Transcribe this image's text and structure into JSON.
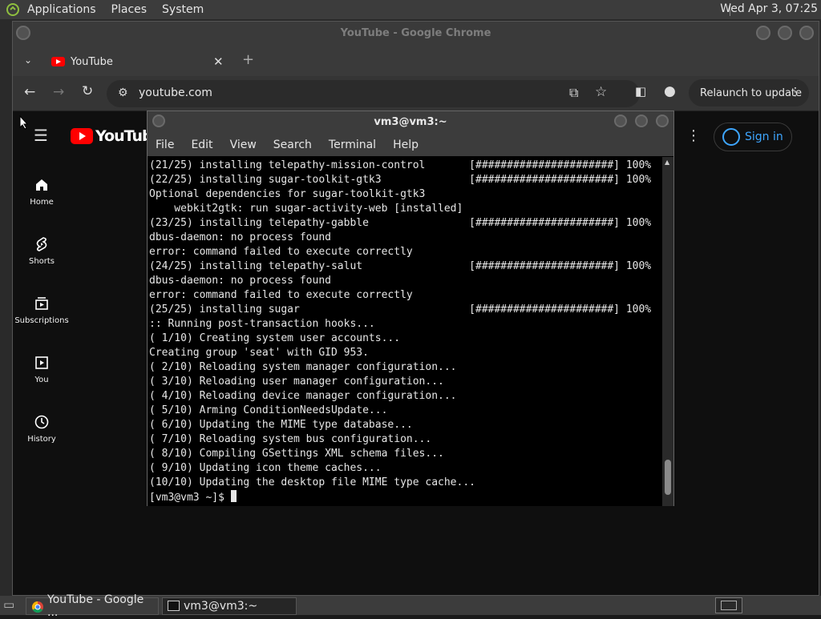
{
  "topbar": {
    "menus": [
      "Applications",
      "Places",
      "System"
    ],
    "clock": "Wed Apr 3, 07:25"
  },
  "chrome": {
    "window_title": "YouTube - Google Chrome",
    "tab_title": "YouTube",
    "url": "youtube.com",
    "relaunch_label": "Relaunch to update"
  },
  "youtube": {
    "logo_text": "YouTube",
    "signin_label": "Sign in",
    "sidebar": [
      {
        "label": "Home"
      },
      {
        "label": "Shorts"
      },
      {
        "label": "Subscriptions"
      },
      {
        "label": "You"
      },
      {
        "label": "History"
      }
    ]
  },
  "terminal": {
    "title": "vm3@vm3:~",
    "menus": [
      "File",
      "Edit",
      "View",
      "Search",
      "Terminal",
      "Help"
    ],
    "lines": [
      "(21/25) installing telepathy-mission-control       [######################] 100%",
      "(22/25) installing sugar-toolkit-gtk3              [######################] 100%",
      "Optional dependencies for sugar-toolkit-gtk3",
      "    webkit2gtk: run sugar-activity-web [installed]",
      "(23/25) installing telepathy-gabble                [######################] 100%",
      "dbus-daemon: no process found",
      "error: command failed to execute correctly",
      "(24/25) installing telepathy-salut                 [######################] 100%",
      "dbus-daemon: no process found",
      "error: command failed to execute correctly",
      "(25/25) installing sugar                           [######################] 100%",
      ":: Running post-transaction hooks...",
      "( 1/10) Creating system user accounts...",
      "Creating group 'seat' with GID 953.",
      "( 2/10) Reloading system manager configuration...",
      "( 3/10) Reloading user manager configuration...",
      "( 4/10) Reloading device manager configuration...",
      "( 5/10) Arming ConditionNeedsUpdate...",
      "( 6/10) Updating the MIME type database...",
      "( 7/10) Reloading system bus configuration...",
      "( 8/10) Compiling GSettings XML schema files...",
      "( 9/10) Updating icon theme caches...",
      "(10/10) Updating the desktop file MIME type cache..."
    ],
    "prompt": "[vm3@vm3 ~]$"
  },
  "taskbar": {
    "items": [
      "YouTube - Google ...",
      "vm3@vm3:~"
    ]
  }
}
